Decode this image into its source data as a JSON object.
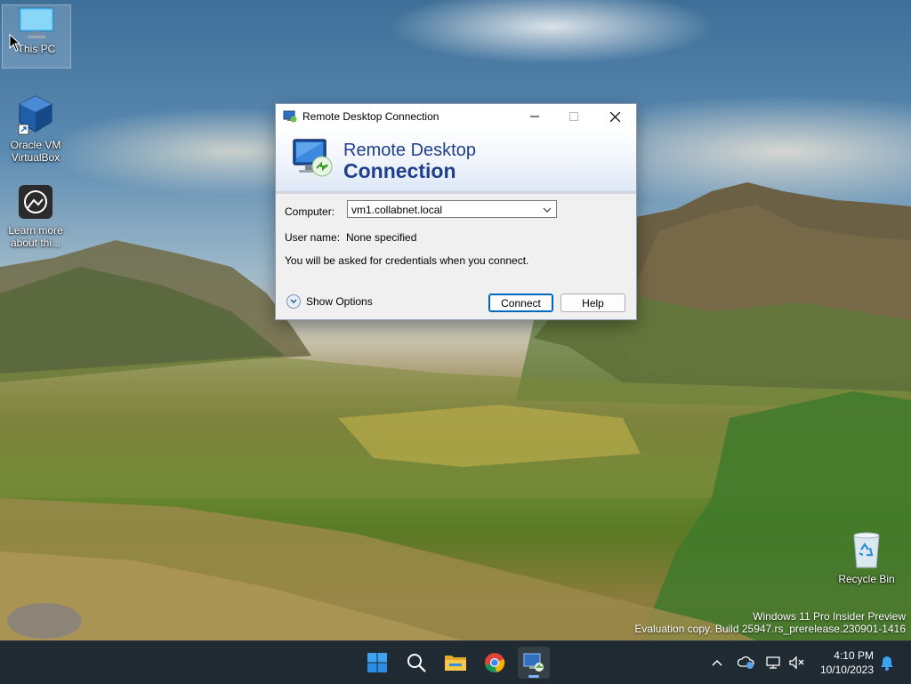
{
  "desktop": {
    "icons": [
      {
        "label": "This PC"
      },
      {
        "label": "Oracle VM VirtualBox"
      },
      {
        "label": "Learn more about thi..."
      },
      {
        "label": "Recycle Bin"
      }
    ],
    "watermark": {
      "line1": "Windows 11 Pro Insider Preview",
      "line2": "Evaluation copy. Build 25947.rs_prerelease.230901-1416"
    }
  },
  "dialog": {
    "title": "Remote Desktop Connection",
    "banner_line1": "Remote Desktop",
    "banner_line2": "Connection",
    "computer_label": "Computer:",
    "computer_value": "vm1.collabnet.local",
    "username_label": "User name:",
    "username_value": "None specified",
    "info_text": "You will be asked for credentials when you connect.",
    "show_options": "Show Options",
    "connect_button": "Connect",
    "help_button": "Help"
  },
  "taskbar": {
    "apps": [
      "start-icon",
      "search-icon",
      "file-explorer-icon",
      "chrome-icon",
      "remote-desktop-icon"
    ],
    "clock_time": "4:10 PM",
    "clock_date": "10/10/2023"
  },
  "colors": {
    "accent": "#0067c0",
    "banner_text": "#1f3f8c",
    "taskbar_bg": "#1f2a33"
  }
}
